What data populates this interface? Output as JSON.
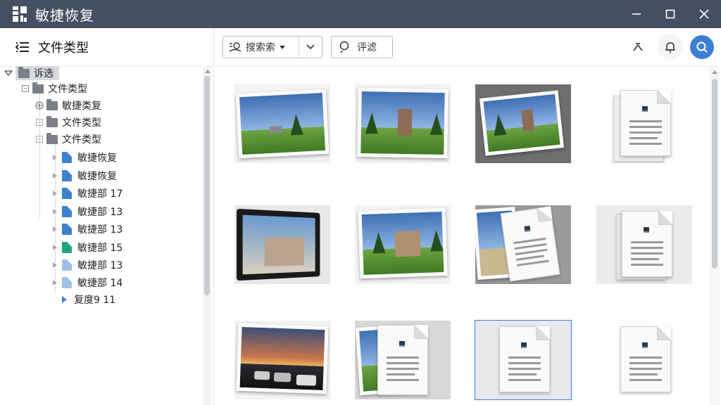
{
  "window": {
    "title": "敏捷恢复",
    "controls": {
      "minimize": "minimize",
      "maximize": "maximize",
      "close": "close"
    }
  },
  "sidebar": {
    "header_title": "文件类型",
    "tree": [
      {
        "label": "诉选",
        "type": "root",
        "icon": "folder-icon"
      },
      {
        "label": "文件类型",
        "type": "folder",
        "icon": "folder-icon"
      },
      {
        "label": "敏捷类复",
        "type": "folder",
        "icon": "folder-icon"
      },
      {
        "label": "文件类型",
        "type": "folder",
        "icon": "folder-icon"
      },
      {
        "label": "文件类型",
        "type": "folder",
        "icon": "folder-icon"
      },
      {
        "label": "敏捷恢复",
        "type": "file",
        "icon": "file-icon",
        "color": "#3c82cf"
      },
      {
        "label": "敏捷恢复",
        "type": "file",
        "icon": "file-icon",
        "color": "#3c82cf"
      },
      {
        "label": "敏捷部 17",
        "type": "file",
        "icon": "file-icon",
        "color": "#3c82cf"
      },
      {
        "label": "敏捷部 13",
        "type": "file",
        "icon": "file-icon",
        "color": "#3c82cf"
      },
      {
        "label": "敏捷部 13",
        "type": "file",
        "icon": "file-icon",
        "color": "#3c82cf"
      },
      {
        "label": "敏捷部 15",
        "type": "file",
        "icon": "file-icon",
        "color": "#1ea47e"
      },
      {
        "label": "敏捷部 13",
        "type": "file",
        "icon": "file-icon",
        "color": "#9fc1e8"
      },
      {
        "label": "敏捷部 14",
        "type": "file",
        "icon": "file-icon",
        "color": "#9fc1e8"
      },
      {
        "label": "复度9  11",
        "type": "item",
        "icon": "play-arrow-icon"
      }
    ]
  },
  "toolbar": {
    "search_label": "搜索索",
    "filter_label": "评滤",
    "icons": [
      "upload-icon",
      "bell-icon",
      "search-icon"
    ]
  },
  "grid": {
    "items": [
      {
        "kind": "photo",
        "subject": "landscape-tree"
      },
      {
        "kind": "photo",
        "subject": "church"
      },
      {
        "kind": "photo",
        "subject": "church-tilted"
      },
      {
        "kind": "document"
      },
      {
        "kind": "photo",
        "subject": "tablet-building"
      },
      {
        "kind": "photo",
        "subject": "church-lawn"
      },
      {
        "kind": "mixed",
        "subject": "photo-doc"
      },
      {
        "kind": "document"
      },
      {
        "kind": "photo",
        "subject": "sunset-cars"
      },
      {
        "kind": "mixed",
        "subject": "photo-doc"
      },
      {
        "kind": "document",
        "selected": true
      },
      {
        "kind": "document"
      }
    ]
  },
  "colors": {
    "titlebar": "#445062",
    "accent": "#3d7fd3",
    "selection": "#d6d9de"
  }
}
